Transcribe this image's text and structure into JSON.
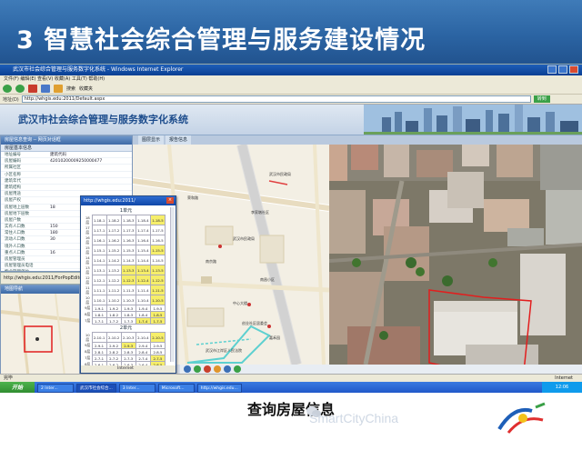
{
  "slide": {
    "title": "3  智慧社会综合管理与服务建设情况",
    "caption": "查询房屋信息",
    "watermark": "SmartCityChina"
  },
  "browser": {
    "window_title": "武汉市社会综合管理与服务数字化系统 - Windows Internet Explorer",
    "menu": "文件(F)  编辑(E)  查看(V)  收藏(A)  工具(T)  帮助(H)",
    "toolbar": {
      "search": "搜索",
      "favorites": "收藏夹"
    },
    "address_label": "地址(D)",
    "address": "http://whgis.edu:2011/Default.aspx",
    "go": "转到",
    "status": "完毕",
    "zone": "Internet"
  },
  "app": {
    "title": "武汉市社会综合管理与服务数字化系统",
    "tabs": [
      "图层显示",
      "报告信息"
    ]
  },
  "left_panel": {
    "header": "房屋信息查询 -- 网页对话框",
    "subheader": "房屋基本信息",
    "rows": [
      {
        "k": "地址编号",
        "v": "建筑代码"
      },
      {
        "k": "房屋编码",
        "v": "42010200009250000477"
      },
      {
        "k": "所属社区",
        "v": ""
      },
      {
        "k": "小区名称",
        "v": ""
      },
      {
        "k": "建筑年代",
        "v": ""
      },
      {
        "k": "建筑结构",
        "v": ""
      },
      {
        "k": "房屋用途",
        "v": ""
      },
      {
        "k": "房屋产权",
        "v": ""
      },
      {
        "k": "房屋地上层数",
        "v": "18"
      },
      {
        "k": "房屋地下层数",
        "v": ""
      },
      {
        "k": "房屋户数",
        "v": ""
      },
      {
        "k": "实有人口数",
        "v": "150"
      },
      {
        "k": "常住人口数",
        "v": "180"
      },
      {
        "k": "流动人口数",
        "v": "30"
      },
      {
        "k": "境外人口数",
        "v": ""
      },
      {
        "k": "重点人口数",
        "v": "16"
      },
      {
        "k": "房屋管理员",
        "v": ""
      },
      {
        "k": "房屋管理员电话",
        "v": ""
      },
      {
        "k": "物业管理单位",
        "v": ""
      },
      {
        "k": "物业管理人员电话",
        "v": ""
      },
      {
        "k": "物业管理单位",
        "v": ""
      }
    ],
    "footer": "http://whgis.edu:2011/ForPopEditor.aspx"
  },
  "nav_panel": {
    "header": "地图导航"
  },
  "popup": {
    "title": "http://whgis.edu:2011/",
    "close": "×",
    "unit1": "1单元",
    "unit2": "2单元",
    "status": "Internet",
    "cols": [
      "1",
      "2",
      "3",
      "4",
      "5"
    ],
    "floors1": [
      "18层",
      "17层",
      "16层",
      "15层",
      "14层",
      "13层",
      "12层",
      "11层",
      "10层",
      "9层",
      "8层",
      "7层"
    ],
    "floors2": [
      "10层",
      "9层",
      "8层",
      "7层",
      "6层",
      "5层",
      "4层",
      "3层",
      "2层",
      "1层"
    ],
    "cells1": [
      [
        "1-18-1",
        "1-18-2",
        "1-18-3",
        "1-18-4",
        "1-18-5"
      ],
      [
        "1-17-1",
        "1-17-2",
        "1-17-3",
        "1-17-4",
        "1-17-5"
      ],
      [
        "1-16-1",
        "1-16-2",
        "1-16-3",
        "1-16-4",
        "1-16-5"
      ],
      [
        "1-15-1",
        "1-15-2",
        "1-15-3",
        "1-15-4",
        "1-15-5"
      ],
      [
        "1-14-1",
        "1-14-2",
        "1-14-3",
        "1-14-4",
        "1-14-5"
      ],
      [
        "1-13-1",
        "1-13-2",
        "1-13-3",
        "1-13-4",
        "1-13-5"
      ],
      [
        "1-12-1",
        "1-12-2",
        "1-12-3",
        "1-12-4",
        "1-12-5"
      ],
      [
        "1-11-1",
        "1-11-2",
        "1-11-3",
        "1-11-4",
        "1-11-5"
      ],
      [
        "1-10-1",
        "1-10-2",
        "1-10-3",
        "1-10-4",
        "1-10-5"
      ],
      [
        "1-9-1",
        "1-9-2",
        "1-9-3",
        "1-9-4",
        "1-9-5"
      ],
      [
        "1-8-1",
        "1-8-2",
        "1-8-3",
        "1-8-4",
        "1-8-5"
      ],
      [
        "1-7-1",
        "1-7-2",
        "1-7-3",
        "1-7-4",
        "1-7-5"
      ]
    ],
    "cells2": [
      [
        "2-10-1",
        "2-10-2",
        "2-10-3",
        "2-10-4",
        "2-10-5"
      ],
      [
        "2-9-1",
        "2-9-2",
        "2-9-3",
        "2-9-4",
        "2-9-5"
      ],
      [
        "2-8-1",
        "2-8-2",
        "2-8-3",
        "2-8-4",
        "2-8-5"
      ],
      [
        "2-7-1",
        "2-7-2",
        "2-7-3",
        "2-7-4",
        "2-7-5"
      ],
      [
        "2-6-1",
        "2-6-2",
        "2-6-3",
        "2-6-4",
        "2-6-5"
      ],
      [
        "2-5-1",
        "2-5-2",
        "2-5-3",
        "2-5-4",
        "2-5-5"
      ],
      [
        "2-4-1",
        "2-4-2",
        "2-4-3",
        "2-4-4",
        "2-4-5"
      ],
      [
        "2-3-1",
        "2-3-2",
        "2-3-3",
        "2-3-4",
        "2-3-5"
      ],
      [
        "2-2-1",
        "2-2-2",
        "2-2-3",
        "2-2-4",
        "2-2-5"
      ],
      [
        "2-1-1",
        "2-1-2",
        "2-1-3",
        "2-1-4",
        "2-1-5"
      ]
    ],
    "highlight1": [
      [
        0,
        4
      ],
      [
        3,
        4
      ],
      [
        5,
        2
      ],
      [
        5,
        3
      ],
      [
        5,
        4
      ],
      [
        6,
        2
      ],
      [
        6,
        3
      ],
      [
        6,
        4
      ],
      [
        7,
        4
      ],
      [
        8,
        4
      ],
      [
        10,
        4
      ],
      [
        11,
        3
      ],
      [
        11,
        4
      ]
    ],
    "highlight2": [
      [
        0,
        4
      ],
      [
        1,
        2
      ],
      [
        3,
        4
      ],
      [
        4,
        4
      ],
      [
        6,
        3
      ],
      [
        7,
        4
      ],
      [
        8,
        4
      ]
    ]
  },
  "map_labels": [
    "武汉市民政局",
    "荣和路",
    "李家墩社区",
    "武汉市民政局",
    "南京路",
    "南昌小区",
    "中心大楼",
    "创业社区居委会",
    "嘉禾园",
    "武汉市江岸区人民法院"
  ],
  "taskbar": {
    "start": "开始",
    "tasks": [
      "2 Inter...",
      "武汉市社会综合...",
      "3 Inter...",
      "Microsoft...",
      "http://whgis.edu..."
    ],
    "tray": "12:06"
  },
  "colors": {
    "title_bg": "#2b64a3",
    "highlight_cell": "#f6ee6a",
    "taskbar": "#1e56c8"
  }
}
